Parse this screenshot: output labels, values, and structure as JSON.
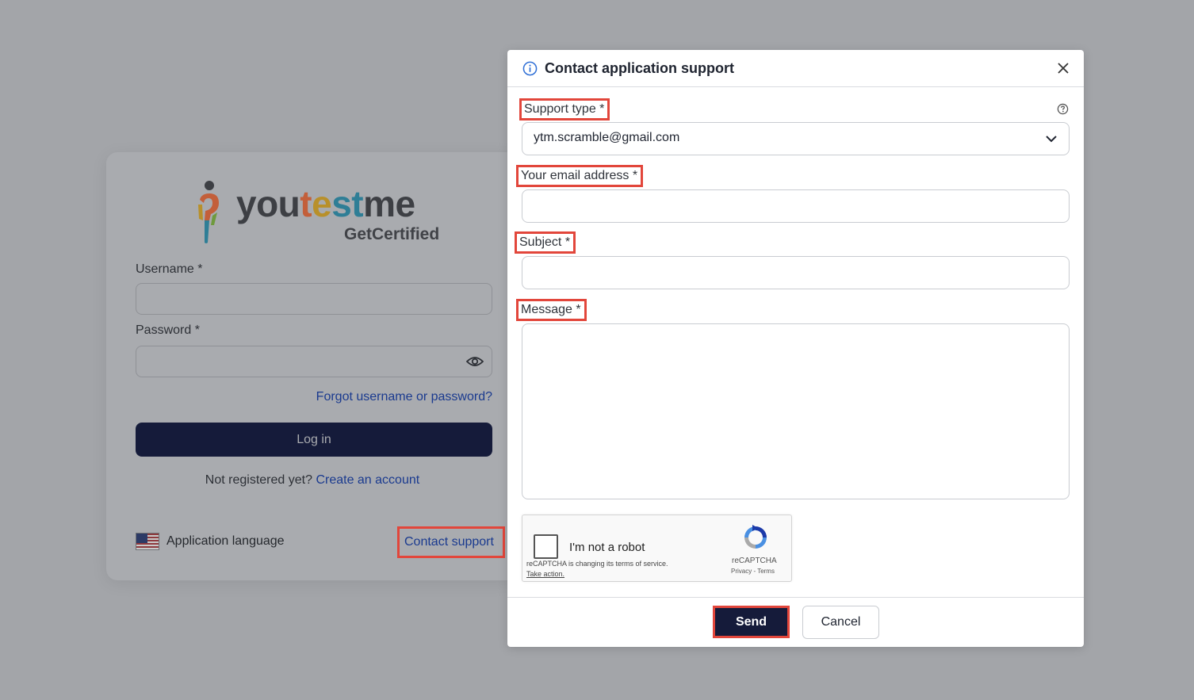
{
  "login": {
    "logo_parts": [
      "you",
      "t",
      "e",
      "st",
      "me"
    ],
    "logo_sub": "GetCertified",
    "username_label": "Username *",
    "password_label": "Password *",
    "forgot_link": "Forgot username or password?",
    "login_button": "Log in",
    "not_registered": "Not registered yet?",
    "create_account": "Create an account",
    "app_language": "Application language",
    "contact_support": "Contact support"
  },
  "modal": {
    "title": "Contact application support",
    "support_type_label": "Support type *",
    "support_type_value": "ytm.scramble@gmail.com",
    "email_label": "Your email address *",
    "email_value": "",
    "subject_label": "Subject *",
    "subject_value": "",
    "message_label": "Message *",
    "message_value": "",
    "captcha": {
      "checkbox_label": "I'm not a robot",
      "note": "reCAPTCHA is changing its terms of service.",
      "take_action": "Take action.",
      "brand": "reCAPTCHA",
      "links": "Privacy - Terms"
    },
    "send_button": "Send",
    "cancel_button": "Cancel"
  },
  "colors": {
    "overlay": "#a3a5a9",
    "primary_button": "#151b3a",
    "highlight_border": "#e2463b",
    "link": "#1a3a8f"
  }
}
